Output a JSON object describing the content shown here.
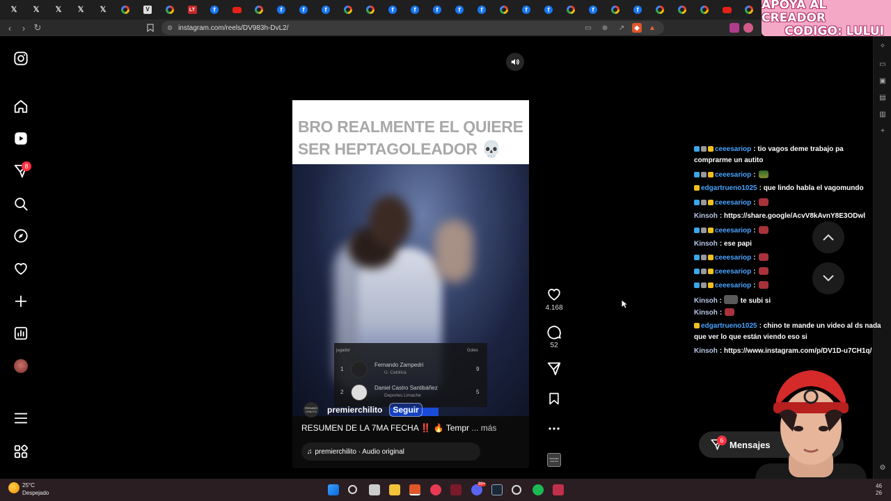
{
  "browser": {
    "tabs": [
      "x",
      "x",
      "x",
      "x",
      "x",
      "g",
      "v",
      "g",
      "lt",
      "f",
      "yt",
      "g",
      "f",
      "f",
      "f",
      "g",
      "g",
      "f",
      "f",
      "f",
      "f",
      "f",
      "g",
      "f",
      "f",
      "g",
      "f",
      "g",
      "f",
      "g",
      "g",
      "g",
      "yt",
      "g"
    ],
    "url": "instagram.com/reels/DV983h-DvL2/"
  },
  "overlay_banner": {
    "line1": "APOYA AL CREADOR",
    "line2": "CODIGO: LULUI"
  },
  "nav": {
    "notification_count": "8",
    "items": [
      "instagram-logo",
      "home",
      "reels",
      "messages",
      "search",
      "explore",
      "notifications",
      "create",
      "dashboard",
      "profile",
      "more",
      "also-from-meta"
    ]
  },
  "reel": {
    "caption_overlay": "BRO REALMENTE EL QUIERE SER HEPTAGOLEADOR 💀",
    "stats_table": {
      "header_player": "jugador",
      "header_goals": "Goles",
      "rows": [
        {
          "rank": "1",
          "name": "Fernando Zampedri",
          "team": "U. Católica",
          "goals": "9"
        },
        {
          "rank": "2",
          "name": "Daniel Castro Santibáñez",
          "team": "Deportes Limache",
          "goals": "5"
        }
      ]
    },
    "author_avatar_text": "PREMIER CHILITO",
    "author": "premierchilito",
    "follow_label": "Seguir",
    "description": "RESUMEN DE LA 7MA FECHA ‼️ 🔥 Tempr",
    "more_label": "... más",
    "audio": "premierchilito · Audio original",
    "likes": "4.168",
    "comments": "52",
    "audio_thumb_text": "PREMIER CHILITO"
  },
  "chat": [
    {
      "user": "ceeesariop",
      "msg": ": tio vagos deme trabajo pa",
      "msg2": "comprarme un autito",
      "badges": 3
    },
    {
      "user": "ceeesariop",
      "msg": ":",
      "emote": "car",
      "badges": 3
    },
    {
      "user": "edgartrueno1025",
      "msg": ": que lindo habla el vagomundo",
      "badges": 1
    },
    {
      "user": "ceeesariop",
      "msg": ":",
      "emote": "red",
      "badges": 3
    },
    {
      "user": "Kinsoh",
      "msg": ": https://share.google/AcvV8kAvnY8E3ODwl",
      "badges": 0
    },
    {
      "user": "ceeesariop",
      "msg": ":",
      "emote": "red",
      "badges": 3
    },
    {
      "user": "Kinsoh",
      "msg": ": ese papi",
      "badges": 0
    },
    {
      "user": "ceeesariop",
      "msg": ":",
      "emote": "red",
      "badges": 3
    },
    {
      "user": "ceeesariop",
      "msg": ":",
      "emote": "red",
      "badges": 3
    },
    {
      "user": "ceeesariop",
      "msg": ":",
      "emote": "red",
      "badges": 3
    },
    {
      "user": "Kinsoh",
      "msg": "te subi si",
      "emote": "photo",
      "badges": 0
    },
    {
      "user": "Kinsoh",
      "msg": ":",
      "emote": "red",
      "badges": 0
    },
    {
      "user": "edgartrueno1025",
      "msg": ": chino te mande un video al ds nada",
      "msg2": "que ver lo que están viendo eso si",
      "badges": 1
    },
    {
      "user": "Kinsoh",
      "msg": ": https://www.instagram.com/p/DV1D-u7CH1q/",
      "badges": 0
    }
  ],
  "messages_pill": {
    "label": "Mensajes",
    "count": "6"
  },
  "taskbar": {
    "temperature": "25°C",
    "weather": "Despejado",
    "discord_badge": "99+",
    "clock_line1": "46",
    "clock_line2": "26"
  },
  "colors": {
    "like_red": "#ff3040",
    "chat_user": "#4aa3ff",
    "banner_pink": "#f5a8c6"
  }
}
